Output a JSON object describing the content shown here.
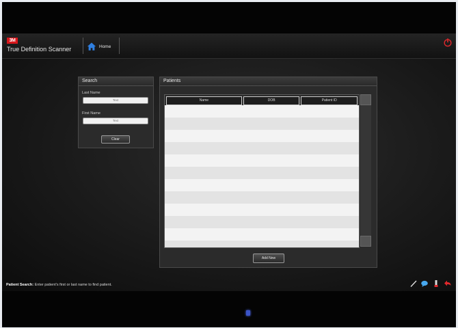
{
  "brand": {
    "logo": "3M",
    "name": "True Definition Scanner"
  },
  "nav": {
    "home_label": "Home"
  },
  "search": {
    "title": "Search",
    "last_name_label": "Last Name",
    "last_name_value": "",
    "last_name_placeholder": "Text",
    "first_name_label": "First Name",
    "first_name_value": "",
    "first_name_placeholder": "Text",
    "clear_label": "Clear"
  },
  "patients": {
    "title": "Patients",
    "columns": [
      "Name",
      "DOB",
      "Patient ID"
    ],
    "rows": [],
    "add_button_label": "Add New"
  },
  "status": {
    "prefix": "Patient Search:",
    "message": "Enter patient's first or last name to find patient."
  },
  "icons": {
    "home": "home-icon",
    "power": "power-icon",
    "pen": "pen-icon",
    "chat": "chat-bubble-icon",
    "scanner": "scanner-wand-icon",
    "back": "back-arrow-icon"
  },
  "colors": {
    "brand_red": "#d8161b",
    "power_red": "#e0282c",
    "accent_blue": "#2f7fe0"
  }
}
